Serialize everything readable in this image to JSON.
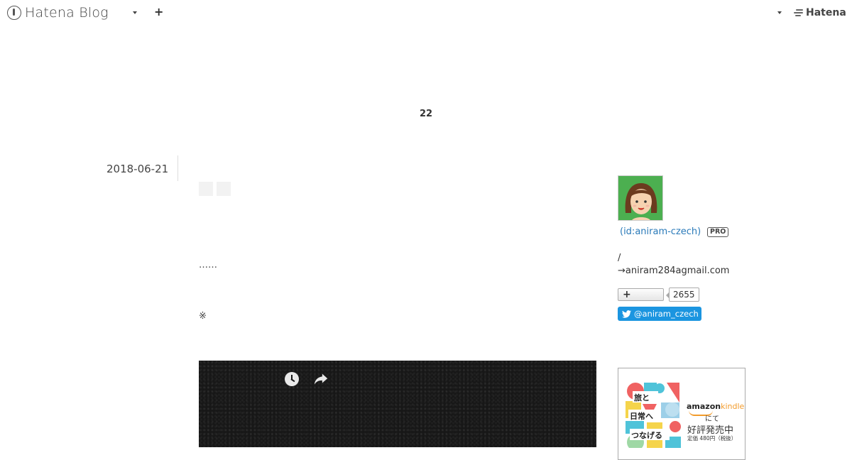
{
  "header": {
    "brand": "Hatena Blog",
    "right_brand": "Hatena",
    "add_label": "+"
  },
  "blog": {
    "title": "22"
  },
  "entry": {
    "date": "2018-06-21",
    "ellipsis": "……",
    "note_mark": "※"
  },
  "sidebar": {
    "user_id": "(id:aniram-czech)",
    "pro_badge": "PRO",
    "slash": "/",
    "email": "→aniram284agmail.com",
    "follow_plus": "+",
    "follower_count": "2655",
    "twitter_handle": "@aniram_czech"
  },
  "ad": {
    "amazon": "amazon",
    "kindle": "kindle",
    "nite": "にて",
    "hatsubai": "好評発売中",
    "price": "定価 480円（税抜）",
    "cover_lines": [
      "旅と",
      "日常へ",
      "つなげる"
    ]
  },
  "colors": {
    "link": "#2a7ab9",
    "twitter": "#1b95e0",
    "avatar_bg": "#4caf50",
    "video_bg": "#151515"
  },
  "icons": [
    "hatena-blog-logo-icon",
    "caret-down-icon",
    "plus-icon",
    "hatena-mark-icon",
    "clock-icon",
    "share-icon",
    "twitter-bird-icon"
  ]
}
